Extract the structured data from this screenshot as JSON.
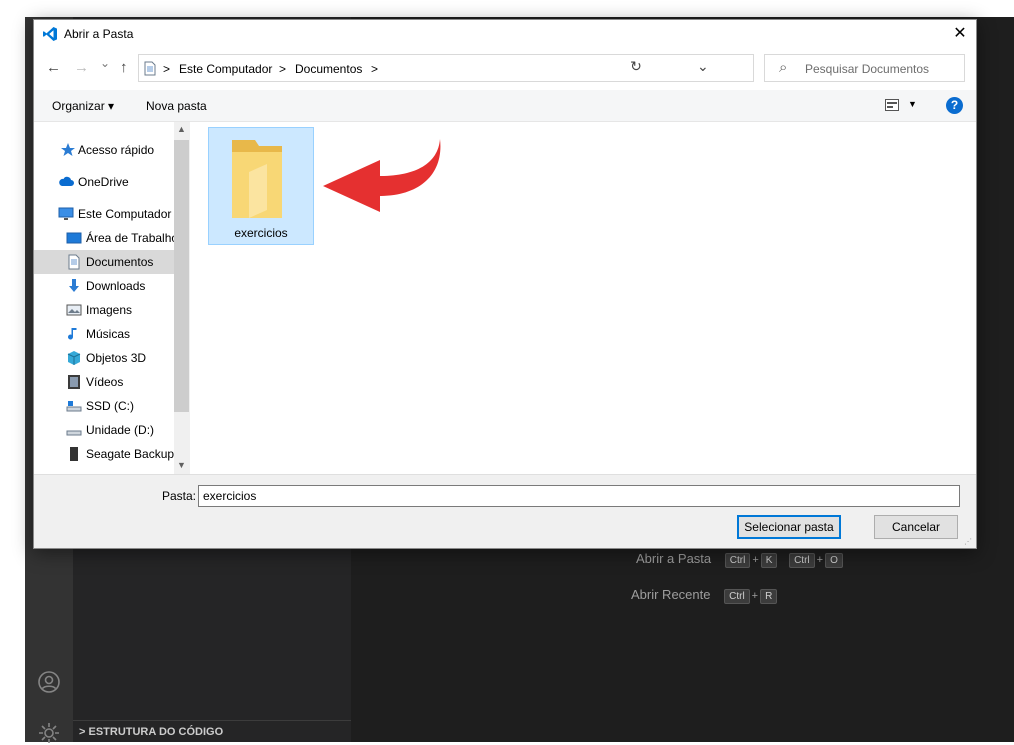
{
  "dialog": {
    "title": "Abrir a Pasta",
    "close_glyph": "✕",
    "nav": {
      "back": "←",
      "forward": "→",
      "recent": "⌄",
      "up": "↑"
    },
    "breadcrumb": [
      ">",
      "Este Computador",
      ">",
      "Documentos",
      ">"
    ],
    "address_dropdown": "⌄",
    "refresh": "↻",
    "search_placeholder": "Pesquisar Documentos",
    "search_icon": "⌕",
    "toolbar": {
      "organize": "Organizar ▾",
      "new_folder": "Nova pasta",
      "help": "?"
    },
    "nav_items": [
      {
        "label": "Acesso rápido",
        "icon": "star-icon"
      },
      {
        "label": "OneDrive",
        "icon": "cloud-icon"
      },
      {
        "label": "Este Computador",
        "icon": "computer-icon"
      },
      {
        "label": "Área de Trabalho",
        "icon": "desktop-icon"
      },
      {
        "label": "Documentos",
        "icon": "document-icon"
      },
      {
        "label": "Downloads",
        "icon": "download-icon"
      },
      {
        "label": "Imagens",
        "icon": "image-icon"
      },
      {
        "label": "Músicas",
        "icon": "music-icon"
      },
      {
        "label": "Objetos 3D",
        "icon": "cube-icon"
      },
      {
        "label": "Vídeos",
        "icon": "video-icon"
      },
      {
        "label": "SSD (C:)",
        "icon": "drive-icon"
      },
      {
        "label": "Unidade (D:)",
        "icon": "drive-icon"
      },
      {
        "label": "Seagate Backup",
        "icon": "external-drive-icon"
      }
    ],
    "content_items": [
      {
        "label": "exercicios",
        "icon": "folder-icon"
      }
    ],
    "folder_label": "Pasta:",
    "folder_value": "exercicios",
    "select_button": "Selecionar pasta",
    "cancel_button": "Cancelar"
  },
  "vscode": {
    "open_folder": "Abrir a Pasta",
    "open_folder_keys": [
      "Ctrl",
      "+",
      "K",
      "Ctrl",
      "+",
      "O"
    ],
    "open_recent": "Abrir Recente",
    "open_recent_keys": [
      "Ctrl",
      "+",
      "R"
    ],
    "outline": "> ESTRUTURA DO CÓDIGO"
  },
  "colors": {
    "accent": "#0078d7",
    "selection": "#cce8ff",
    "arrow": "#e53030",
    "folder": "#f8d775"
  }
}
